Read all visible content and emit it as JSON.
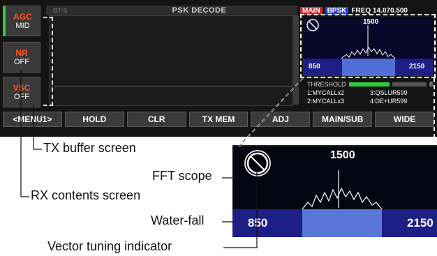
{
  "side_buttons": [
    {
      "top": "AGC",
      "bottom": "MID"
    },
    {
      "top": "NR",
      "bottom": "OFF"
    },
    {
      "top": "VSC",
      "bottom": "OFF"
    }
  ],
  "screen": {
    "title": "PSK DECODE",
    "dim_text": "BT-S",
    "status": {
      "main": "MAIN",
      "mode": "BPSK",
      "freq": "FREQ 14.070.500"
    },
    "scope": {
      "center": "1500",
      "low": "850",
      "high": "2150"
    },
    "threshold_label": "THRESHOLD",
    "threshold_value": "8",
    "memories": [
      "1:MYCALLx2",
      "3:QSLUR599",
      "2:MYCALLx3",
      "4:DE+UR599"
    ]
  },
  "function_keys": [
    "MENU1",
    "HOLD",
    "CLR",
    "TX MEM",
    "ADJ",
    "MAIN/SUB",
    "WIDE"
  ],
  "callouts": {
    "tx_buffer": "TX buffer screen",
    "fft_scope": "FFT scope",
    "rx_contents": "RX contents screen",
    "waterfall": "Water-fall",
    "vector": "Vector tuning indicator"
  },
  "zoom": {
    "center": "1500",
    "low": "850",
    "high": "2150"
  },
  "colors": {
    "screen_bg": "#141414",
    "accent_red": "#ff5522",
    "agc_green": "#2ecc40",
    "waterfall_blue": "#1d1f86",
    "main_tag": "#d12a2a",
    "bpsk_tag": "#2a3fd1"
  }
}
